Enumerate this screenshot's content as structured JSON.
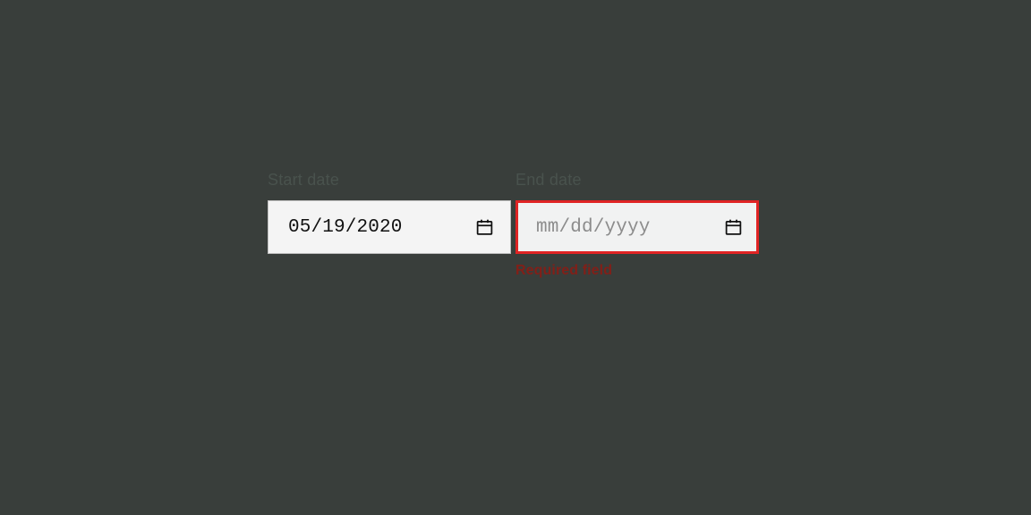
{
  "start": {
    "label": "Start date",
    "value": "05/19/2020"
  },
  "end": {
    "label": "End date",
    "placeholder": "mm/dd/yyyy",
    "error": "Required field"
  },
  "colors": {
    "error_border": "#e02424",
    "field_bg": "#f4f4f4"
  }
}
